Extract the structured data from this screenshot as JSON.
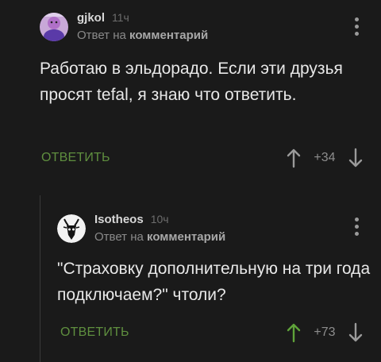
{
  "comments": [
    {
      "username": "gjkol",
      "time": "11ч",
      "reply_prefix": "Ответ на",
      "reply_target": "комментарий",
      "text": "Работаю в эльдорадо. Если эти друзья просят tefal, я знаю что ответить.",
      "reply_label": "ОТВЕТИТЬ",
      "score": "+34",
      "upvoted": false,
      "avatar_icon": "user-avatar-photo"
    },
    {
      "username": "Isotheos",
      "time": "10ч",
      "reply_prefix": "Ответ на",
      "reply_target": "комментарий",
      "text": "\"Страховку дополнительную на три года подключаем?\" чтоли?",
      "reply_label": "ОТВЕТИТЬ",
      "score": "+73",
      "upvoted": true,
      "avatar_icon": "goat-skull-avatar"
    }
  ],
  "colors": {
    "background": "#1a1a1a",
    "accent_green": "#5f8f3f",
    "upvote_active": "#5fa33a",
    "muted": "#8d8d8d"
  }
}
